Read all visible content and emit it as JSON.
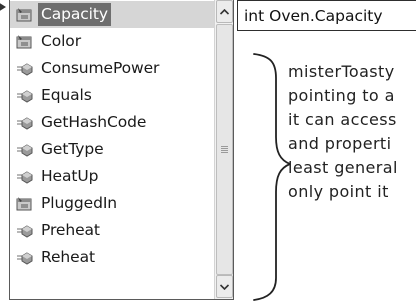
{
  "intellisense": {
    "items": [
      {
        "label": "Capacity",
        "kind": "property",
        "selected": true
      },
      {
        "label": "Color",
        "kind": "property",
        "selected": false
      },
      {
        "label": "ConsumePower",
        "kind": "method",
        "selected": false
      },
      {
        "label": "Equals",
        "kind": "method",
        "selected": false
      },
      {
        "label": "GetHashCode",
        "kind": "method",
        "selected": false
      },
      {
        "label": "GetType",
        "kind": "method",
        "selected": false
      },
      {
        "label": "HeatUp",
        "kind": "method",
        "selected": false
      },
      {
        "label": "PluggedIn",
        "kind": "property",
        "selected": false
      },
      {
        "label": "Preheat",
        "kind": "method",
        "selected": false
      },
      {
        "label": "Reheat",
        "kind": "method",
        "selected": false
      }
    ],
    "scrollbar": {
      "up_icon": "chevron-up-icon",
      "down_icon": "chevron-down-icon"
    }
  },
  "tooltip": {
    "text": "int Oven.Capacity"
  },
  "annotation": {
    "lines": [
      "misterToasty",
      "pointing to a",
      "it can access",
      "and properti",
      "least general",
      "only point it"
    ]
  },
  "colors": {
    "selection_bg": "#6e6e6e",
    "selection_fg": "#ffffff",
    "text": "#1a1a1a",
    "border": "#5a5a5a",
    "property_icon": "#7a7a7a",
    "method_icon": "#7a7a7a"
  }
}
